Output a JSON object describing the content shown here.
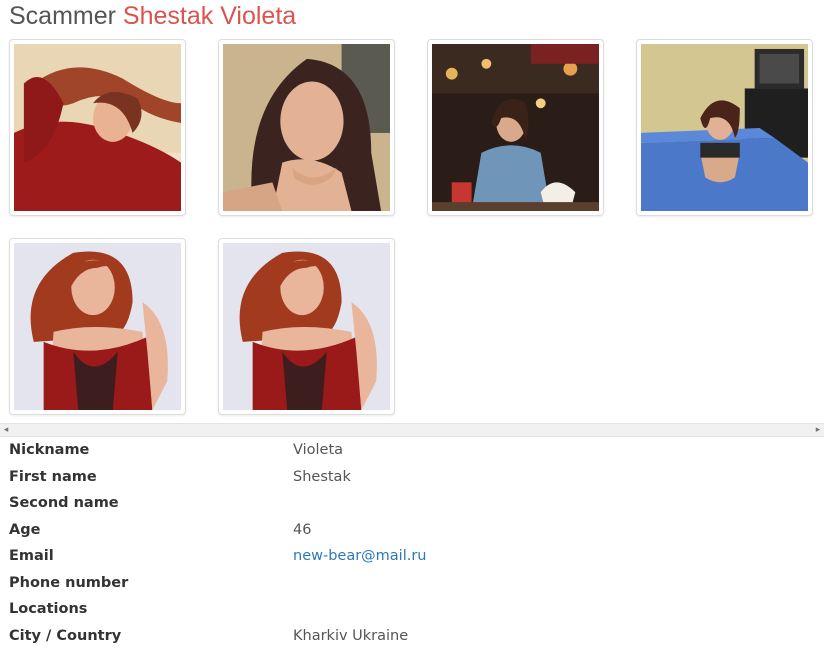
{
  "header": {
    "prefix": "Scammer",
    "name": "Shestak Violeta"
  },
  "photos": [
    {
      "description_icon": "photo-woman-red-sweater"
    },
    {
      "description_icon": "photo-woman-portrait"
    },
    {
      "description_icon": "photo-woman-restaurant"
    },
    {
      "description_icon": "photo-woman-on-bed"
    },
    {
      "description_icon": "photo-woman-red-corset"
    },
    {
      "description_icon": "photo-woman-red-corset"
    }
  ],
  "profile": {
    "rows": [
      {
        "label": "Nickname",
        "value": "Violeta"
      },
      {
        "label": "First name",
        "value": "Shestak"
      },
      {
        "label": "Second name",
        "value": ""
      },
      {
        "label": "Age",
        "value": "46"
      },
      {
        "label": "Email",
        "value": "new-bear@mail.ru"
      },
      {
        "label": "Phone number",
        "value": ""
      },
      {
        "label": "Locations",
        "value": ""
      },
      {
        "label": "City / Country",
        "value": "Kharkiv Ukraine"
      }
    ]
  },
  "scrollbar": {
    "left_arrow": "◂",
    "right_arrow": "▸"
  },
  "colors": {
    "name_accent": "#d9534f",
    "link": "#2a7ab8"
  }
}
